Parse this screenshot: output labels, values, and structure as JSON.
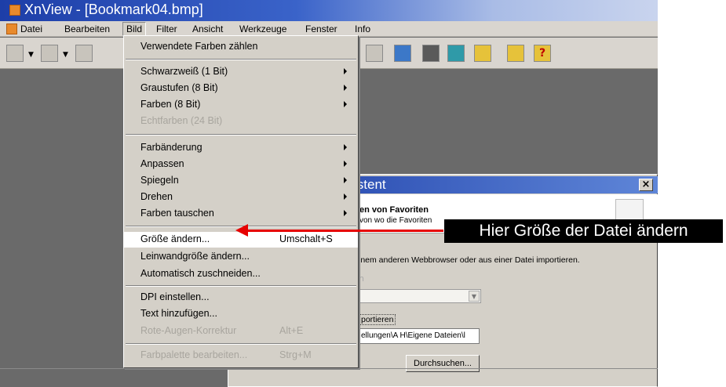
{
  "window": {
    "title": "XnView - [Bookmark04.bmp]"
  },
  "menubar": {
    "items": [
      "Datei",
      "Bearbeiten",
      "Bild",
      "Filter",
      "Ansicht",
      "Werkzeuge",
      "Fenster",
      "Info"
    ],
    "active": "Bild"
  },
  "bild_menu": {
    "items": [
      {
        "label": "Verwendete Farben zählen",
        "enabled": true
      },
      {
        "label": "Schwarzweiß (1 Bit)",
        "submenu": true,
        "enabled": true
      },
      {
        "label": "Graustufen (8 Bit)",
        "submenu": true,
        "enabled": true
      },
      {
        "label": "Farben (8 Bit)",
        "submenu": true,
        "enabled": true
      },
      {
        "label": "Echtfarben (24 Bit)",
        "enabled": false
      },
      {
        "label": "Farbänderung",
        "submenu": true,
        "enabled": true
      },
      {
        "label": "Anpassen",
        "submenu": true,
        "enabled": true
      },
      {
        "label": "Spiegeln",
        "submenu": true,
        "enabled": true
      },
      {
        "label": "Drehen",
        "submenu": true,
        "enabled": true
      },
      {
        "label": "Farben tauschen",
        "submenu": true,
        "enabled": true
      },
      {
        "label": "Größe ändern...",
        "shortcut": "Umschalt+S",
        "enabled": true,
        "highlighted": true
      },
      {
        "label": "Leinwandgröße ändern...",
        "enabled": true
      },
      {
        "label": "Automatisch zuschneiden...",
        "enabled": true
      },
      {
        "label": "DPI einstellen...",
        "enabled": true
      },
      {
        "label": "Text hinzufügen...",
        "enabled": true
      },
      {
        "label": "Rote-Augen-Korrektur",
        "shortcut": "Alt+E",
        "enabled": false
      },
      {
        "label": "Farbpalette bearbeiten...",
        "shortcut": "Strg+M",
        "enabled": false
      }
    ]
  },
  "dialog": {
    "title": "istent",
    "header_bold": "en von Favoriten",
    "header_sub": "von wo die Favoriten",
    "body_text": "inem anderen Webbrowser oder aus einer Datei importieren.",
    "faded_text": "n",
    "import_label": "portieren",
    "path_value": "ellungen\\A H\\Eigene Dateien\\l",
    "browse_button": "Durchsuchen...",
    "close_glyph": "×"
  },
  "annotation": {
    "text": "Hier Größe der Datei ändern",
    "color": "#e60000"
  }
}
